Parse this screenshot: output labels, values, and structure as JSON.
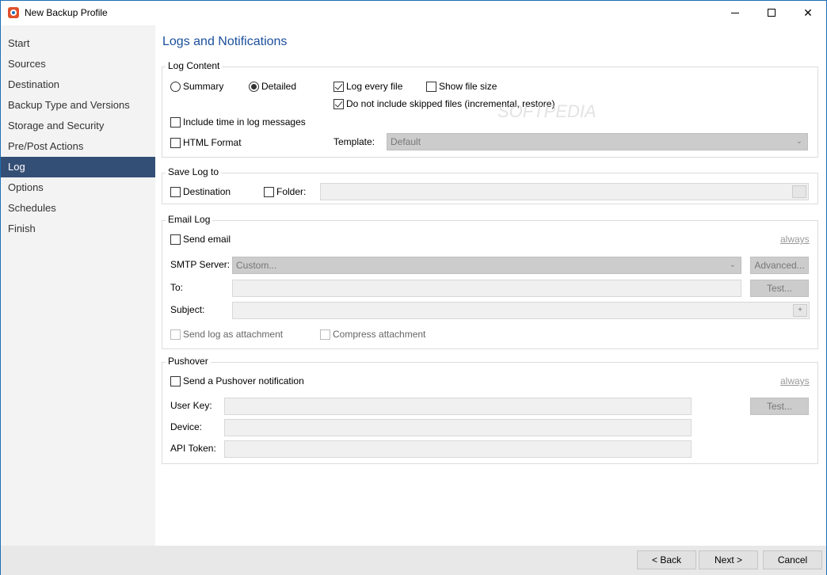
{
  "window": {
    "title": "New Backup Profile"
  },
  "sidebar": {
    "items": [
      {
        "label": "Start"
      },
      {
        "label": "Sources"
      },
      {
        "label": "Destination"
      },
      {
        "label": "Backup Type and Versions"
      },
      {
        "label": "Storage and Security"
      },
      {
        "label": "Pre/Post Actions"
      },
      {
        "label": "Log"
      },
      {
        "label": "Options"
      },
      {
        "label": "Schedules"
      },
      {
        "label": "Finish"
      }
    ],
    "active": "Log",
    "active_color": "#344f75"
  },
  "main": {
    "title": "Logs and Notifications",
    "title_color": "#1b4f9c",
    "log_content": {
      "legend": "Log Content",
      "summary_label": "Summary",
      "detailed_label": "Detailed",
      "selected_mode": "Detailed",
      "log_every_file_label": "Log every file",
      "log_every_file_checked": true,
      "show_file_size_label": "Show file size",
      "show_file_size_checked": false,
      "skip_label": "Do not include skipped files (incremental, restore)",
      "skip_checked": true,
      "include_time_label": "Include time in log messages",
      "include_time_checked": false,
      "html_format_label": "HTML Format",
      "html_format_checked": false,
      "template_label": "Template:",
      "template_value": "Default"
    },
    "save_log": {
      "legend": "Save Log to",
      "destination_label": "Destination",
      "folder_label": "Folder:"
    },
    "email_log": {
      "legend": "Email Log",
      "send_email_label": "Send email",
      "always_link": "always",
      "smtp_label": "SMTP Server:",
      "smtp_value": "Custom...",
      "advanced_button": "Advanced...",
      "to_label": "To:",
      "test_button": "Test...",
      "subject_label": "Subject:",
      "subject_plus": "+",
      "attach_label": "Send log as attachment",
      "compress_label": "Compress attachment"
    },
    "pushover": {
      "legend": "Pushover",
      "send_label": "Send a Pushover notification",
      "always_link": "always",
      "user_key_label": "User Key:",
      "device_label": "Device:",
      "api_token_label": "API Token:",
      "test_button": "Test..."
    }
  },
  "footer": {
    "back_button": "< Back",
    "next_button": "Next >",
    "cancel_button": "Cancel"
  },
  "watermark": "SOFTPEDIA"
}
